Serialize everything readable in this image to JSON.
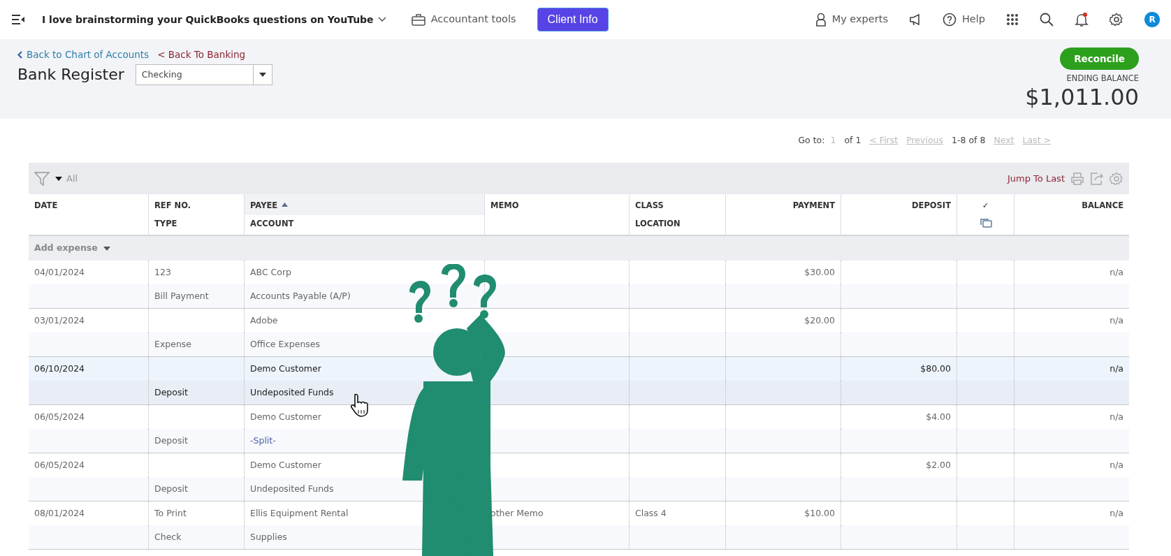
{
  "topbar": {
    "company": "I love brainstorming your QuickBooks questions on YouTube",
    "accountant_tools": "Accountant tools",
    "client_info": "Client Info",
    "my_experts": "My experts",
    "help": "Help",
    "avatar": "R",
    "has_notification": true
  },
  "header": {
    "back_links": [
      {
        "label": "Back to Chart of Accounts",
        "kind": "chevron"
      },
      {
        "label": "< Back To Banking",
        "kind": "plain"
      }
    ],
    "title": "Bank Register",
    "account": "Checking",
    "reconcile": "Reconcile",
    "ending_balance_label": "ENDING BALANCE",
    "ending_balance": "$1,011.00"
  },
  "pagination": {
    "goto_label": "Go to:",
    "page": "1",
    "page_count": "of 1",
    "range": "1-8 of 8",
    "links": [
      {
        "label": "< First",
        "disabled": true
      },
      {
        "label": "Previous",
        "disabled": true
      },
      {
        "label": "Next",
        "disabled": true
      },
      {
        "label": "Last >",
        "disabled": true
      }
    ]
  },
  "toolbar": {
    "filter": "All",
    "jump": "Jump To Last"
  },
  "columns": [
    {
      "top": "DATE",
      "kind": "text",
      "sorted": false
    },
    {
      "top": "REF NO.",
      "bottom": "TYPE",
      "kind": "text",
      "sorted": false
    },
    {
      "top": "PAYEE",
      "bottom": "ACCOUNT",
      "kind": "text",
      "sorted": true
    },
    {
      "top": "MEMO",
      "kind": "text",
      "sorted": false
    },
    {
      "top": "CLASS",
      "bottom": "LOCATION",
      "kind": "text",
      "sorted": false
    },
    {
      "top": "PAYMENT",
      "kind": "amount",
      "sorted": false
    },
    {
      "top": "DEPOSIT",
      "kind": "amount",
      "sorted": false
    },
    {
      "top": "✓",
      "kind": "check",
      "sorted": false
    },
    {
      "top": "BALANCE",
      "kind": "amount",
      "sorted": false
    }
  ],
  "add_row": "Add expense",
  "rows": [
    {
      "date": "04/01/2024",
      "ref_no": "123",
      "type": "Bill Payment",
      "payee": "ABC Corp",
      "account": "Accounts Payable (A/P)",
      "split": false,
      "payment": "$30.00",
      "balance": "n/a",
      "selected": false
    },
    {
      "date": "03/01/2024",
      "type": "Expense",
      "payee": "Adobe",
      "account": "Office Expenses",
      "split": false,
      "payment": "$20.00",
      "balance": "n/a",
      "selected": false
    },
    {
      "date": "06/10/2024",
      "type": "Deposit",
      "payee": "Demo Customer",
      "account": "Undeposited Funds",
      "split": false,
      "deposit": "$80.00",
      "balance": "n/a",
      "selected": true
    },
    {
      "date": "06/05/2024",
      "type": "Deposit",
      "payee": "Demo Customer",
      "account": "-Split-",
      "split": true,
      "deposit": "$4.00",
      "balance": "n/a",
      "selected": false
    },
    {
      "date": "06/05/2024",
      "type": "Deposit",
      "payee": "Demo Customer",
      "account": "Undeposited Funds",
      "split": false,
      "deposit": "$2.00",
      "balance": "n/a",
      "selected": false
    },
    {
      "date": "08/01/2024",
      "ref_no": "To Print",
      "type": "Check",
      "payee": "Ellis Equipment Rental",
      "account": "Supplies",
      "split": false,
      "memo": "other Memo",
      "class": "Class 4",
      "payment": "$10.00",
      "balance": "n/a",
      "selected": false
    }
  ]
}
